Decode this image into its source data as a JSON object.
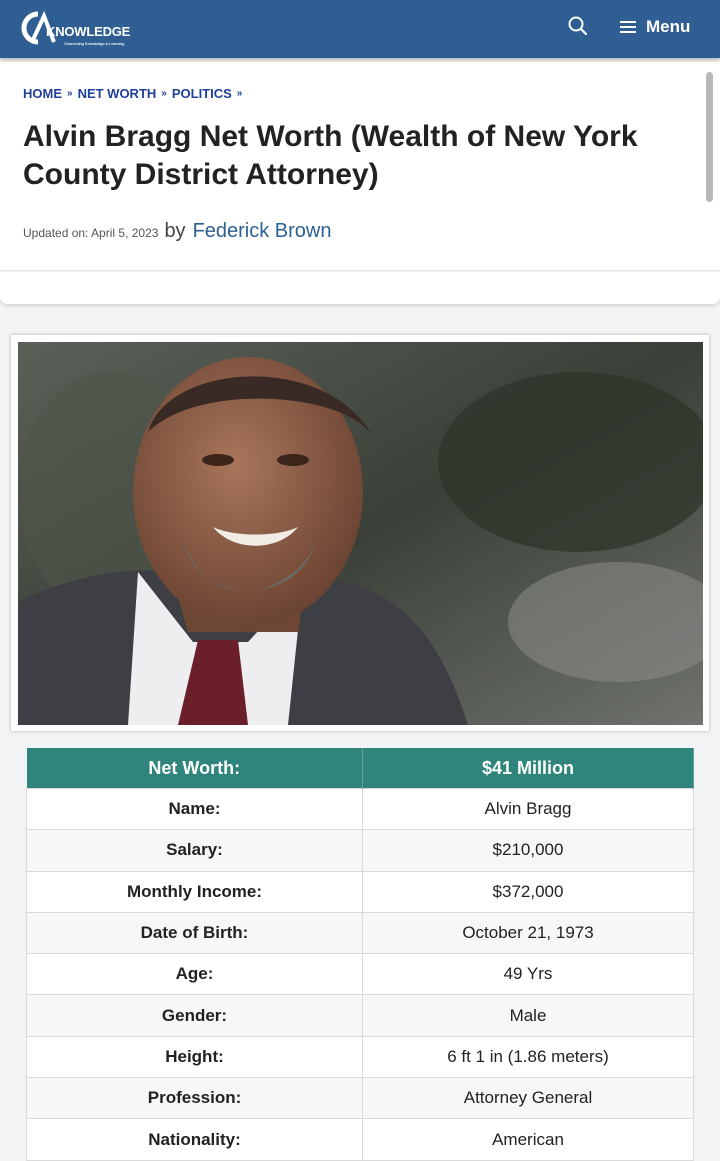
{
  "header": {
    "logo_text": "KNOWLEDGE",
    "logo_tagline": "Connecting Knowledge & Learning",
    "menu_label": "Menu",
    "icons": [
      "logo-icon",
      "search-icon",
      "hamburger-icon"
    ]
  },
  "breadcrumb": {
    "items": [
      "HOME",
      "NET WORTH",
      "POLITICS"
    ],
    "separator": "»"
  },
  "article": {
    "title": "Alvin Bragg Net Worth (Wealth of New York County District Attorney)",
    "updated_label": "Updated on: April 5, 2023",
    "by_label": "by",
    "author": "Federick Brown"
  },
  "colors": {
    "header_bg": "#2f5f92",
    "table_header_bg": "#2f857b",
    "breadcrumb": "#1f3f9a",
    "author_link": "#2d5f92"
  },
  "table": {
    "header": {
      "key": "Net Worth:",
      "value": "$41 Million"
    },
    "rows": [
      {
        "key": "Name:",
        "value": "Alvin Bragg"
      },
      {
        "key": "Salary:",
        "value": "$210,000"
      },
      {
        "key": "Monthly Income:",
        "value": "$372,000"
      },
      {
        "key": "Date of Birth:",
        "value": "October 21, 1973"
      },
      {
        "key": "Age:",
        "value": "49 Yrs"
      },
      {
        "key": "Gender:",
        "value": "Male"
      },
      {
        "key": "Height:",
        "value": "6 ft 1 in (1.86 meters)"
      },
      {
        "key": "Profession:",
        "value": "Attorney General"
      },
      {
        "key": "Nationality:",
        "value": "American"
      }
    ]
  }
}
